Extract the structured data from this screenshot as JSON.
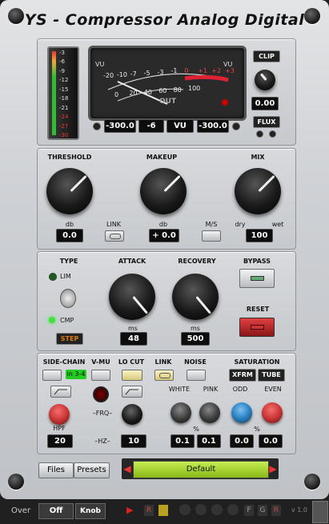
{
  "title": "YS - Compressor Analog Digital",
  "meter": {
    "scale": [
      "-3",
      "-6",
      "-9",
      "-12",
      "-15",
      "-18",
      "-21",
      "-24",
      "-27",
      "-30"
    ],
    "vu_top_scale": [
      "-20",
      "-10",
      "-7",
      "-5",
      "-3",
      "-1",
      "0",
      "+1",
      "+2",
      "+3"
    ],
    "vu_bottom_scale": [
      "0",
      "20",
      "40",
      "60",
      "80",
      "100"
    ],
    "vu_left": "VU",
    "vu_right": "VU",
    "out_label": "OUT",
    "readout_left": "-300.0",
    "readout_mid": "-6",
    "readout_mode": "VU",
    "readout_right": "-300.0",
    "clip_label": "CLIP",
    "clip_value": "0.00",
    "flux_label": "FLUX"
  },
  "gain": {
    "threshold_label": "THRESHOLD",
    "threshold_unit": "db",
    "threshold_value": "0.0",
    "makeup_label": "MAKEUP",
    "makeup_unit": "db",
    "makeup_value": "+ 0.0",
    "link_label": "LINK",
    "ms_label": "M/S",
    "mix_label": "MIX",
    "mix_dry": "dry",
    "mix_wet": "wet",
    "mix_value": "100"
  },
  "dynamics": {
    "type_label": "TYPE",
    "lim_label": "LIM",
    "cmp_label": "CMP",
    "step_label": "STEP",
    "attack_label": "ATTACK",
    "attack_unit": "ms",
    "attack_value": "48",
    "recovery_label": "RECOVERY",
    "recovery_unit": "ms",
    "recovery_value": "500",
    "bypass_label": "BYPASS",
    "reset_label": "RESET"
  },
  "sidechain": {
    "sidechain_label": "SIDE-CHAIN",
    "sc_input": "in 3-4",
    "vmu_label": "V-MU",
    "locut_label": "LO CUT",
    "link_label": "LINK",
    "noise_label": "NOISE",
    "saturation_label": "SATURATION",
    "xfrm_label": "XFRM",
    "tube_label": "TUBE",
    "hpf_label": "HPF",
    "hpf_value": "20",
    "frq_label": "–FRQ–",
    "hz_label": "–HZ–",
    "hz_value": "10",
    "white_label": "WHITE",
    "pink_label": "PINK",
    "noise_unit": "%",
    "white_value": "0.1",
    "pink_value": "0.1",
    "odd_label": "ODD",
    "even_label": "EVEN",
    "sat_unit": "%",
    "odd_value": "0.0",
    "even_value": "0.0"
  },
  "footer": {
    "files_label": "Files",
    "presets_label": "Presets",
    "preset_name": "Default"
  },
  "hostbar": {
    "over_label": "Over",
    "off_label": "Off",
    "knob_label": "Knob",
    "r_label": "R",
    "f_label": "F",
    "g_label": "G",
    "r2_label": "R",
    "version": "v 1.0"
  },
  "colors": {
    "green_led": "#3ee23e",
    "red_button": "#c0282a",
    "preset_green": "#a8d62a",
    "step_orange": "#e07a10",
    "hpf_knob": "#d23b3b",
    "odd_knob": "#2f87c9",
    "even_knob": "#d23b3b"
  }
}
